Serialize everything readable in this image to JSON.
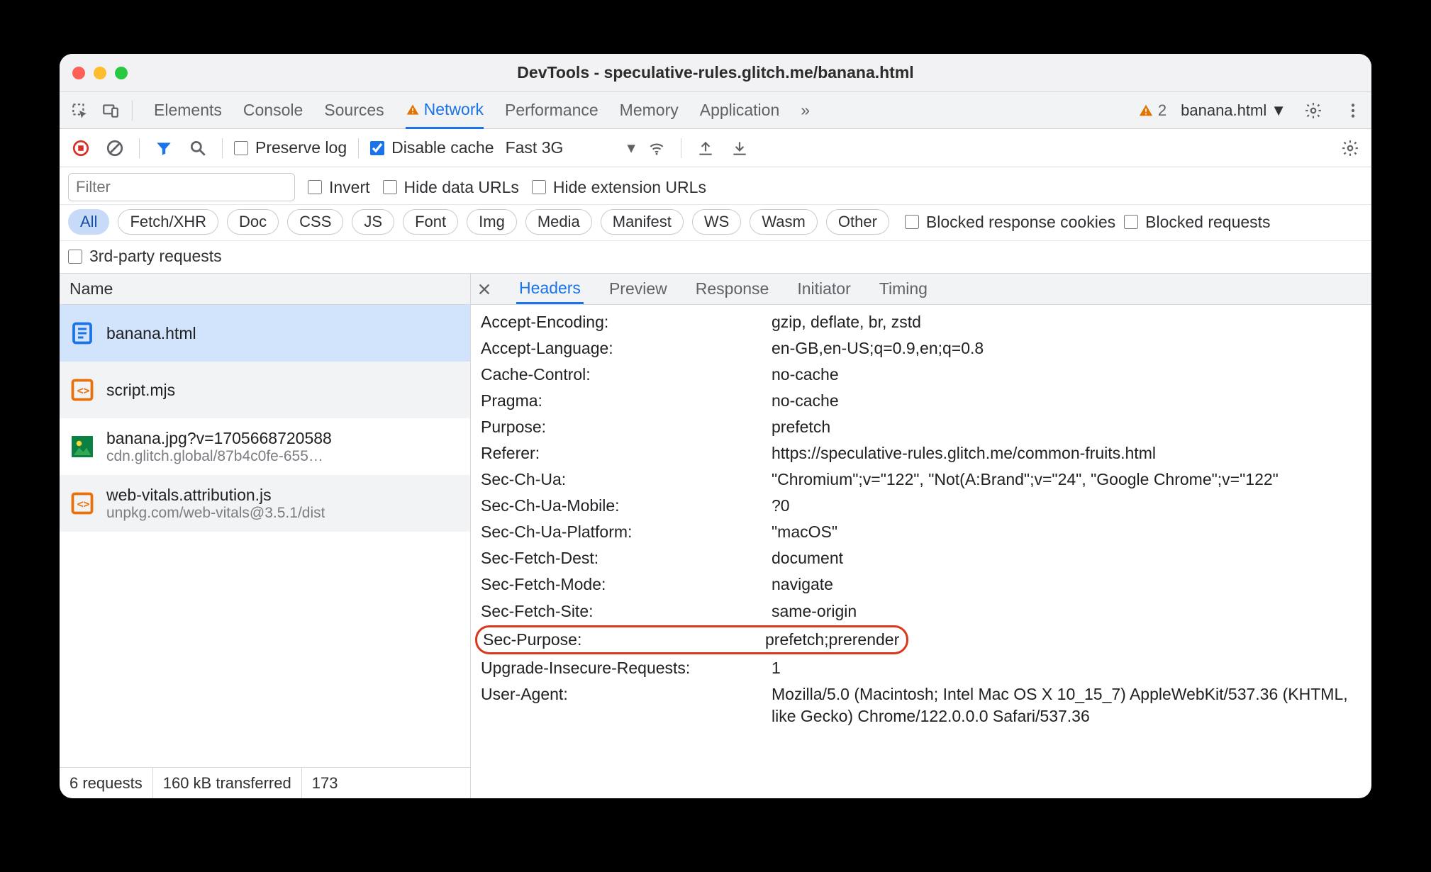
{
  "window": {
    "title": "DevTools - speculative-rules.glitch.me/banana.html"
  },
  "tabs": {
    "items": [
      "Elements",
      "Console",
      "Sources",
      "Network",
      "Performance",
      "Memory",
      "Application"
    ],
    "more_glyph": "»",
    "active_index": 3,
    "warning_count": "2",
    "context": "banana.html"
  },
  "toolbar": {
    "preserve_log": "Preserve log",
    "disable_cache": "Disable cache",
    "throttle": "Fast 3G"
  },
  "filter": {
    "placeholder": "Filter",
    "invert": "Invert",
    "hide_data_urls": "Hide data URLs",
    "hide_ext_urls": "Hide extension URLs",
    "types": [
      "All",
      "Fetch/XHR",
      "Doc",
      "CSS",
      "JS",
      "Font",
      "Img",
      "Media",
      "Manifest",
      "WS",
      "Wasm",
      "Other"
    ],
    "types_active_index": 0,
    "blocked_cookies": "Blocked response cookies",
    "blocked_requests": "Blocked requests",
    "third_party": "3rd-party requests"
  },
  "name_col": "Name",
  "requests": [
    {
      "name": "banana.html",
      "sub": "",
      "icon": "doc-blue",
      "selected": true
    },
    {
      "name": "script.mjs",
      "sub": "",
      "icon": "js-orange"
    },
    {
      "name": "banana.jpg?v=1705668720588",
      "sub": "cdn.glitch.global/87b4c0fe-655…",
      "icon": "img-green"
    },
    {
      "name": "web-vitals.attribution.js",
      "sub": "unpkg.com/web-vitals@3.5.1/dist",
      "icon": "js-orange"
    }
  ],
  "status": {
    "requests": "6 requests",
    "transferred": "160 kB transferred",
    "resources": "173"
  },
  "detail_tabs": {
    "items": [
      "Headers",
      "Preview",
      "Response",
      "Initiator",
      "Timing"
    ],
    "active_index": 0
  },
  "headers": [
    {
      "k": "Accept-Encoding:",
      "v": "gzip, deflate, br, zstd"
    },
    {
      "k": "Accept-Language:",
      "v": "en-GB,en-US;q=0.9,en;q=0.8"
    },
    {
      "k": "Cache-Control:",
      "v": "no-cache"
    },
    {
      "k": "Pragma:",
      "v": "no-cache"
    },
    {
      "k": "Purpose:",
      "v": "prefetch"
    },
    {
      "k": "Referer:",
      "v": "https://speculative-rules.glitch.me/common-fruits.html"
    },
    {
      "k": "Sec-Ch-Ua:",
      "v": "\"Chromium\";v=\"122\", \"Not(A:Brand\";v=\"24\", \"Google Chrome\";v=\"122\""
    },
    {
      "k": "Sec-Ch-Ua-Mobile:",
      "v": "?0"
    },
    {
      "k": "Sec-Ch-Ua-Platform:",
      "v": "\"macOS\""
    },
    {
      "k": "Sec-Fetch-Dest:",
      "v": "document"
    },
    {
      "k": "Sec-Fetch-Mode:",
      "v": "navigate"
    },
    {
      "k": "Sec-Fetch-Site:",
      "v": "same-origin"
    },
    {
      "k": "Sec-Purpose:",
      "v": "prefetch;prerender",
      "hl": true
    },
    {
      "k": "Upgrade-Insecure-Requests:",
      "v": "1"
    },
    {
      "k": "User-Agent:",
      "v": "Mozilla/5.0 (Macintosh; Intel Mac OS X 10_15_7) AppleWebKit/537.36 (KHTML, like Gecko) Chrome/122.0.0.0 Safari/537.36"
    }
  ]
}
